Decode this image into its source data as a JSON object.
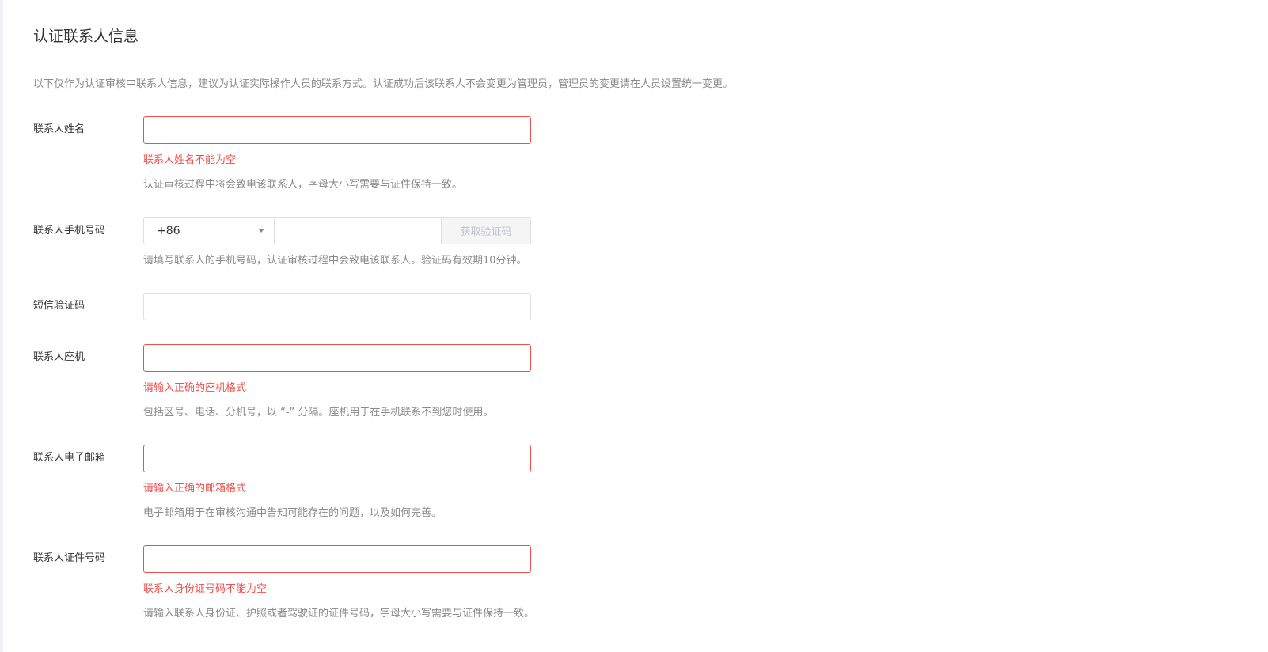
{
  "section": {
    "title": "认证联系人信息",
    "intro": "以下仅作为认证审核中联系人信息，建议为认证实际操作人员的联系方式。认证成功后该联系人不会变更为管理员，管理员的变更请在人员设置统一变更。"
  },
  "fields": {
    "name": {
      "label": "联系人姓名",
      "value": "",
      "error": "联系人姓名不能为空",
      "help": "认证审核过程中将会致电该联系人，字母大小写需要与证件保持一致。"
    },
    "phone": {
      "label": "联系人手机号码",
      "country_code": "+86",
      "value": "",
      "get_code_label": "获取验证码",
      "help": "请填写联系人的手机号码，认证审核过程中会致电该联系人。验证码有效期10分钟。"
    },
    "sms_code": {
      "label": "短信验证码",
      "value": ""
    },
    "landline": {
      "label": "联系人座机",
      "value": "",
      "error": "请输入正确的座机格式",
      "help": "包括区号、电话、分机号，以 “-” 分隔。座机用于在手机联系不到您时使用。"
    },
    "email": {
      "label": "联系人电子邮箱",
      "value": "",
      "error": "请输入正确的邮箱格式",
      "help": "电子邮箱用于在审核沟通中告知可能存在的问题，以及如何完善。"
    },
    "id_number": {
      "label": "联系人证件号码",
      "value": "",
      "error": "联系人身份证号码不能为空",
      "help": "请输入联系人身份证、护照或者驾驶证的证件号码，字母大小写需要与证件保持一致。"
    }
  },
  "colors": {
    "error": "#f0504d",
    "border": "#dcdfe6",
    "muted": "#8a8a8a",
    "text": "#333333"
  }
}
